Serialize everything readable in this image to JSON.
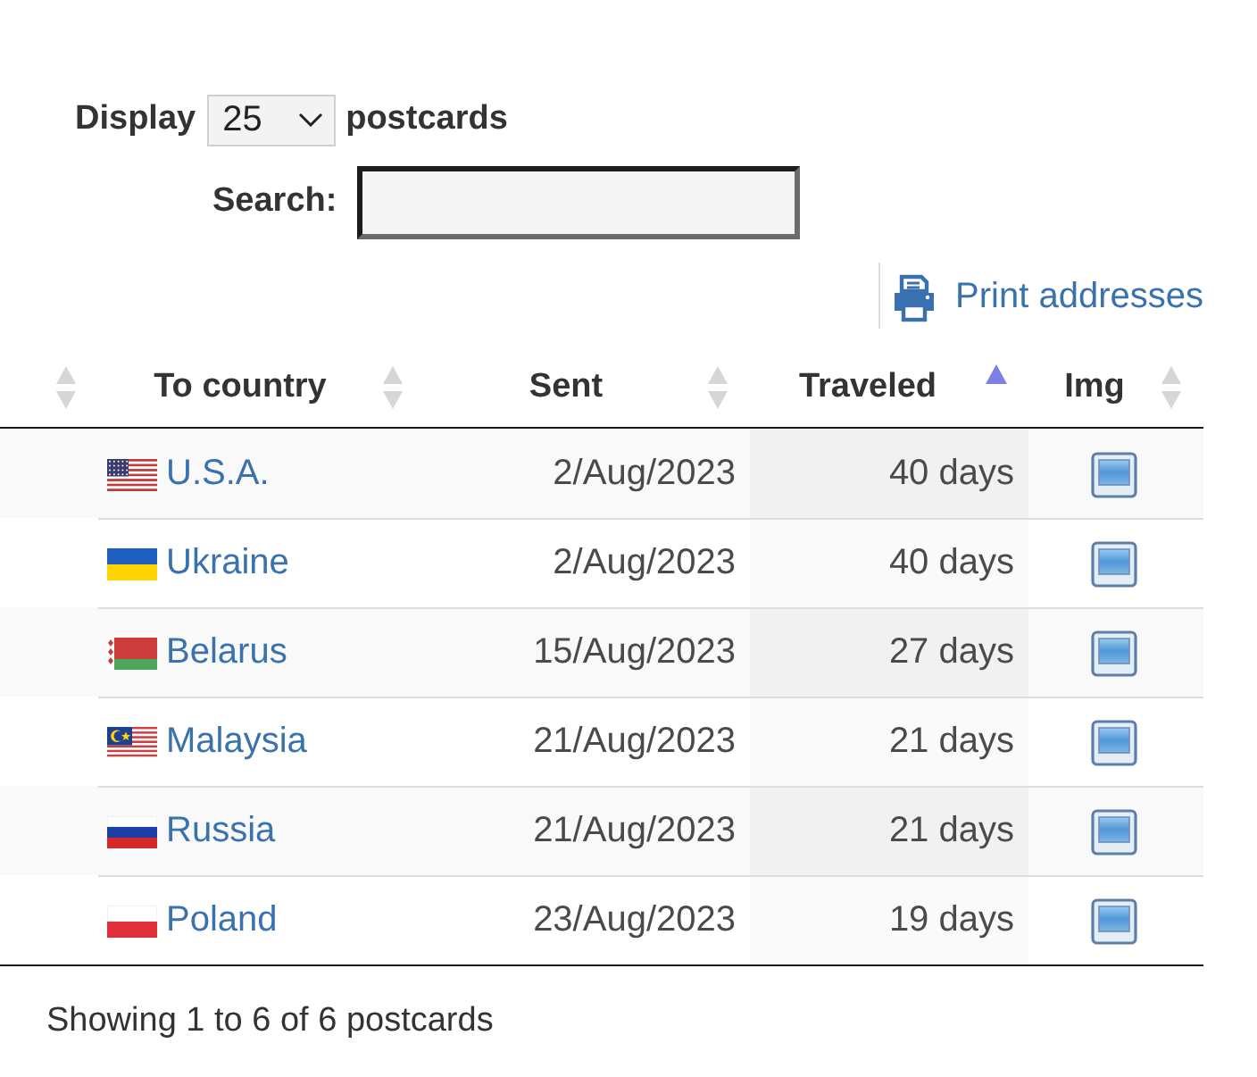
{
  "length_control": {
    "label_before": "Display",
    "value": "25",
    "label_after": "postcards"
  },
  "search": {
    "label": "Search:"
  },
  "print_link": {
    "label": "Print addresses"
  },
  "table": {
    "columns": [
      {
        "sorted": false
      },
      {
        "label": "To country",
        "sorted": false
      },
      {
        "label": "Sent",
        "sorted": false
      },
      {
        "label": "Traveled",
        "sorted": true
      },
      {
        "label": "Img",
        "sorted": false
      }
    ],
    "rows": [
      {
        "kind": "us",
        "country": "U.S.A.",
        "sent": "2/Aug/2023",
        "traveled": "40 days"
      },
      {
        "kind": "ua",
        "country": "Ukraine",
        "sent": "2/Aug/2023",
        "traveled": "40 days"
      },
      {
        "kind": "by",
        "country": "Belarus",
        "sent": "15/Aug/2023",
        "traveled": "27 days"
      },
      {
        "kind": "my",
        "country": "Malaysia",
        "sent": "21/Aug/2023",
        "traveled": "21 days"
      },
      {
        "kind": "ru",
        "country": "Russia",
        "sent": "21/Aug/2023",
        "traveled": "21 days"
      },
      {
        "kind": "pl",
        "country": "Poland",
        "sent": "23/Aug/2023",
        "traveled": "19 days"
      }
    ]
  },
  "info": "Showing 1 to 6 of 6 postcards"
}
